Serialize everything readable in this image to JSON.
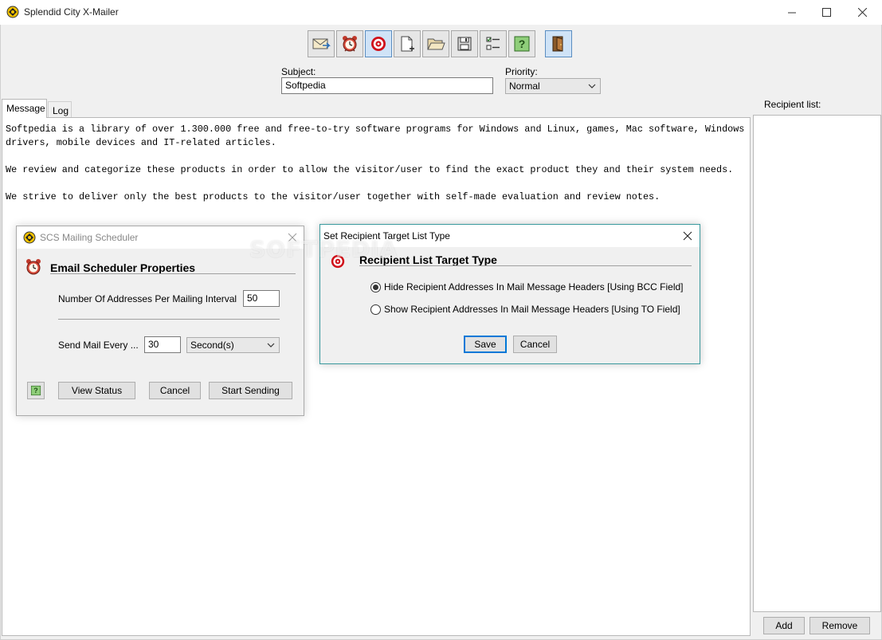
{
  "window": {
    "title": "Splendid City X-Mailer"
  },
  "toolbar": {
    "buttons": [
      "send-mail-icon",
      "alarm-clock-icon",
      "target-icon",
      "new-document-icon",
      "open-folder-icon",
      "save-disk-icon",
      "checklist-icon",
      "help-icon",
      "exit-door-icon"
    ],
    "active_buttons": [
      "target-icon",
      "exit-door-icon"
    ]
  },
  "compose": {
    "subject_label": "Subject:",
    "subject_value": "Softpedia",
    "priority_label": "Priority:",
    "priority_value": "Normal"
  },
  "tabs": {
    "message": "Message",
    "log": "Log"
  },
  "message_body": "Softpedia is a library of over 1.300.000 free and free-to-try software programs for Windows and Linux, games, Mac software, Windows\ndrivers, mobile devices and IT-related articles.\n\nWe review and categorize these products in order to allow the visitor/user to find the exact product they and their system needs.\n\nWe strive to deliver only the best products to the visitor/user together with self-made evaluation and review notes.",
  "recipients": {
    "label": "Recipient list:",
    "add": "Add",
    "remove": "Remove"
  },
  "scheduler_dialog": {
    "title": "SCS Mailing Scheduler",
    "heading": "Email Scheduler Properties",
    "addresses_label": "Number Of Addresses Per Mailing Interval",
    "addresses_value": "50",
    "send_every_label": "Send Mail Every ...",
    "send_every_value": "30",
    "unit_value": "Second(s)",
    "view_status": "View Status",
    "cancel": "Cancel",
    "start_sending": "Start Sending"
  },
  "target_dialog": {
    "title": "Set Recipient Target List Type",
    "heading": "Recipient List Target Type",
    "option_bcc": "Hide Recipient Addresses In Mail Message Headers [Using BCC Field]",
    "option_to": "Show Recipient Addresses In Mail Message Headers [Using TO Field]",
    "selected": "bcc",
    "save": "Save",
    "cancel": "Cancel"
  },
  "watermark": "SOFTPEDIA",
  "colors": {
    "accent": "#0078d7",
    "dialog_border": "#3a9a9e",
    "target_red": "#d0101a"
  }
}
